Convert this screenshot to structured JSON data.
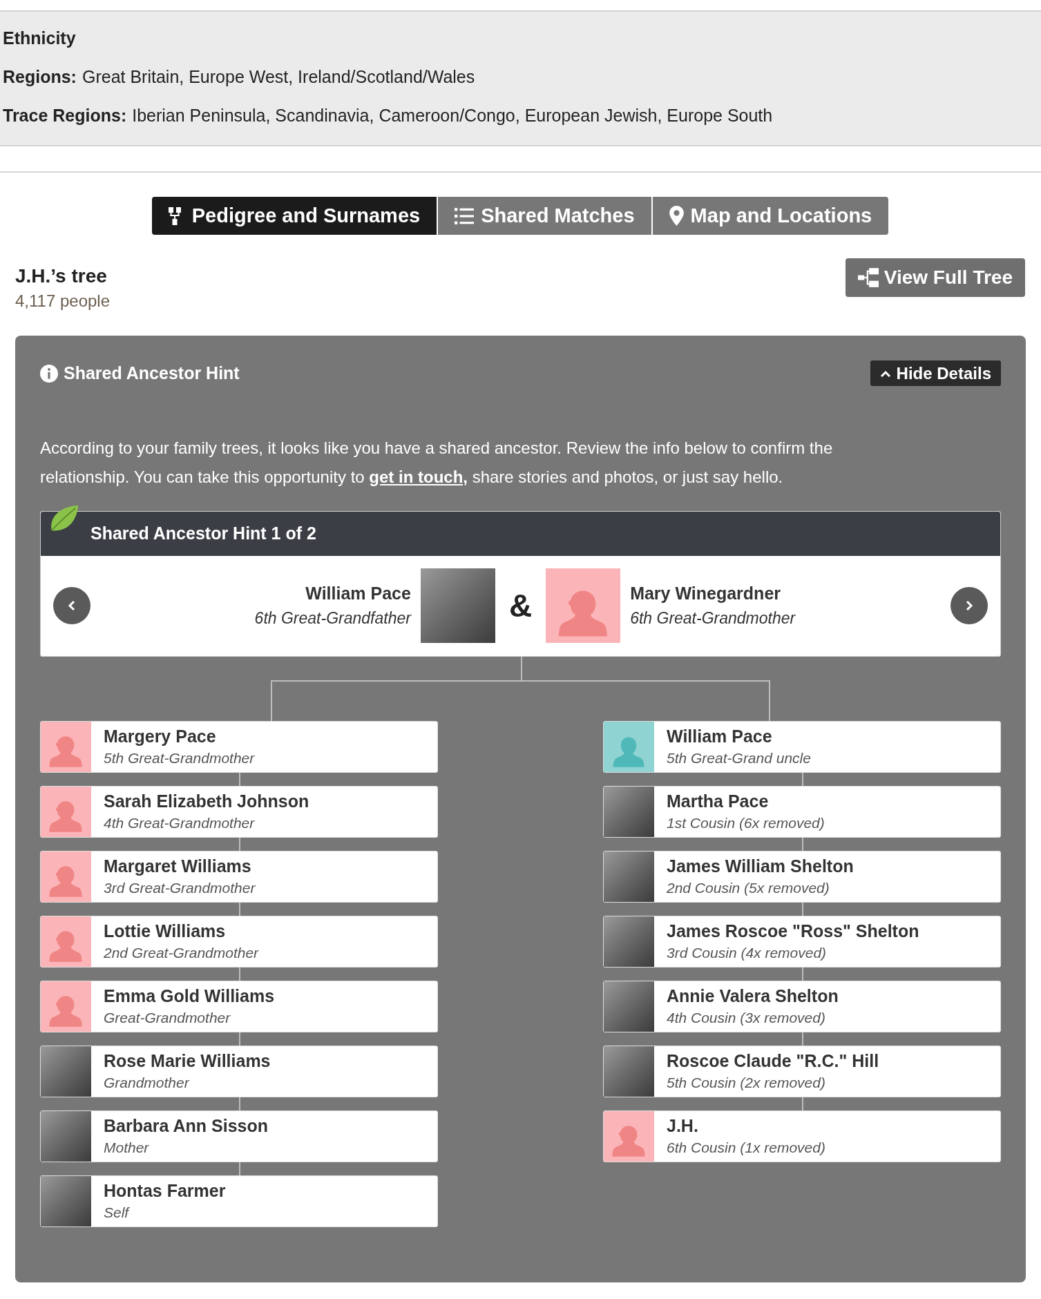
{
  "ethnicity": {
    "title": "Ethnicity",
    "lines": [
      {
        "label": "Regions:",
        "value": "Great Britain, Europe West, Ireland/Scotland/Wales"
      },
      {
        "label": "Trace Regions:",
        "value": "Iberian Peninsula, Scandinavia, Cameroon/Congo, European Jewish, Europe South"
      }
    ]
  },
  "tabs": [
    {
      "label": "Pedigree and Surnames",
      "selected": true
    },
    {
      "label": "Shared Matches",
      "selected": false
    },
    {
      "label": "Map and Locations",
      "selected": false
    }
  ],
  "tree": {
    "title": "J.H.’s tree",
    "count": "4,117 people",
    "button": "View Full Tree"
  },
  "hint_panel": {
    "title": "Shared Ancestor Hint",
    "toggle": "Hide Details",
    "expanded": true,
    "text_before": "According to your family trees, it looks like you have a shared ancestor. Review the info below to confirm the relationship. You can take this opportunity to ",
    "link": "get in touch,",
    "text_after": " share stories and photos, or just say hello.",
    "hint_title": "Shared Ancestor Hint 1 of 2",
    "ancestors": [
      {
        "name": "William Pace",
        "relation": "6th Great-Grandfather",
        "kind": "photo"
      },
      {
        "name": "Mary Winegardner",
        "relation": "6th Great-Grandmother",
        "kind": "female"
      }
    ],
    "ampersand": "&",
    "left_line": [
      {
        "name": "Margery Pace",
        "relation": "5th Great-Grandmother",
        "kind": "female"
      },
      {
        "name": "Sarah Elizabeth Johnson",
        "relation": "4th Great-Grandmother",
        "kind": "female"
      },
      {
        "name": "Margaret Williams",
        "relation": "3rd Great-Grandmother",
        "kind": "female"
      },
      {
        "name": "Lottie Williams",
        "relation": "2nd Great-Grandmother",
        "kind": "female"
      },
      {
        "name": "Emma Gold Williams",
        "relation": "Great-Grandmother",
        "kind": "female"
      },
      {
        "name": "Rose Marie Williams",
        "relation": "Grandmother",
        "kind": "photo"
      },
      {
        "name": "Barbara Ann Sisson",
        "relation": "Mother",
        "kind": "photo"
      },
      {
        "name": "Hontas Farmer",
        "relation": "Self",
        "kind": "photo"
      }
    ],
    "right_line": [
      {
        "name": "William Pace",
        "relation": "5th Great-Grand uncle",
        "kind": "male"
      },
      {
        "name": "Martha Pace",
        "relation": "1st Cousin (6x removed)",
        "kind": "photo"
      },
      {
        "name": "James William Shelton",
        "relation": "2nd Cousin (5x removed)",
        "kind": "photo"
      },
      {
        "name": "James Roscoe \"Ross\" Shelton",
        "relation": "3rd Cousin (4x removed)",
        "kind": "photo"
      },
      {
        "name": "Annie Valera Shelton",
        "relation": "4th Cousin (3x removed)",
        "kind": "photo"
      },
      {
        "name": "Roscoe Claude \"R.C.\" Hill",
        "relation": "5th Cousin (2x removed)",
        "kind": "photo"
      },
      {
        "name": "J.H.",
        "relation": "6th Cousin (1x removed)",
        "kind": "female"
      }
    ]
  }
}
